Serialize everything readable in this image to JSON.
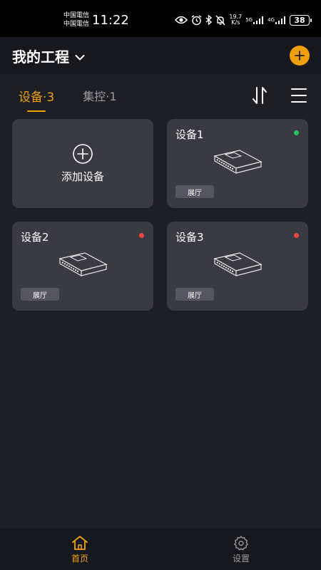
{
  "status_bar": {
    "carrier_1": "中国電信",
    "carrier_2": "中国電信",
    "time": "11:22",
    "net_speed_value": "19.7",
    "net_speed_unit": "K/s",
    "network_5g": "5G",
    "network_4g": "4G",
    "battery": "38"
  },
  "header": {
    "title": "我的工程"
  },
  "tabs": [
    {
      "label": "设备·3",
      "active": true
    },
    {
      "label": "集控·1",
      "active": false
    }
  ],
  "add_device": {
    "label": "添加设备"
  },
  "devices": [
    {
      "name": "设备1",
      "location": "展厅",
      "status_color": "#22c55e"
    },
    {
      "name": "设备2",
      "location": "展厅",
      "status_color": "#ef4444"
    },
    {
      "name": "设备3",
      "location": "展厅",
      "status_color": "#ef4444"
    }
  ],
  "bottom_nav": {
    "home": "首页",
    "settings": "设置"
  },
  "colors": {
    "accent": "#f0a10a",
    "online": "#22c55e",
    "offline": "#ef4444"
  }
}
